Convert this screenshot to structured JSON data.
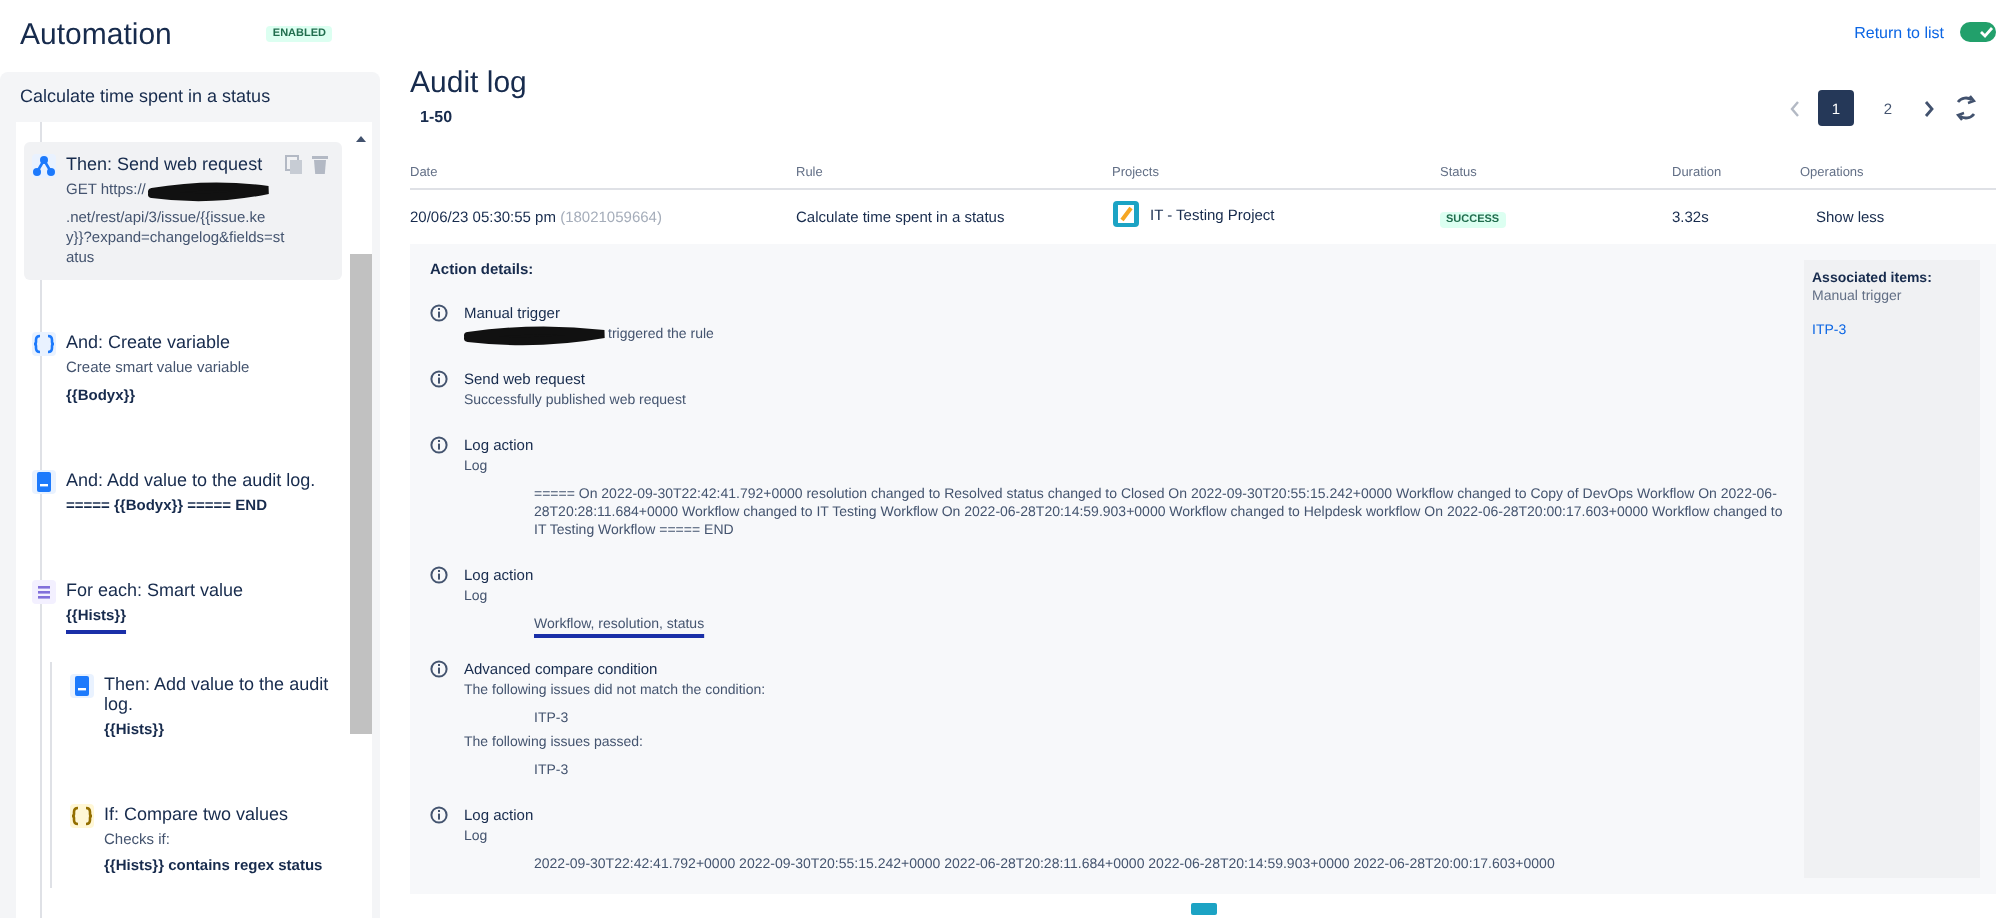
{
  "header": {
    "title": "Automation",
    "status_badge": "ENABLED",
    "return_link": "Return to list",
    "toggle": {
      "on": true
    }
  },
  "sidebar": {
    "rule_name": "Calculate time spent in a status",
    "steps": [
      {
        "kind": "web-request",
        "title": "Then: Send web request",
        "selected": true,
        "parts": [
          {
            "kind": "text",
            "text": "GET https://"
          },
          {
            "kind": "redacted"
          },
          {
            "kind": "break"
          },
          {
            "kind": "text",
            "text": ".net/rest/api/3/issue/{{issue.key}}?expand=changelog&fields=status"
          }
        ]
      },
      {
        "kind": "variable",
        "title": "And: Create variable",
        "selected": false,
        "parts": [
          {
            "kind": "text",
            "text": "Create smart value variable"
          },
          {
            "kind": "value",
            "text": "{{Bodyx}}"
          }
        ]
      },
      {
        "kind": "log",
        "title": "And: Add value to the audit log.",
        "selected": false,
        "parts": [
          {
            "kind": "value",
            "text": "===== {{Bodyx}} ===== END"
          }
        ]
      },
      {
        "kind": "branch",
        "title": "For each: Smart value",
        "selected": false,
        "parts": [
          {
            "kind": "value",
            "text": "{{Hists}}",
            "underlined": true
          }
        ],
        "children": [
          {
            "kind": "log",
            "title": "Then: Add value to the audit log.",
            "selected": false,
            "parts": [
              {
                "kind": "value",
                "text": "{{Hists}}"
              }
            ]
          },
          {
            "kind": "condition",
            "title": "If: Compare two values",
            "selected": false,
            "parts": [
              {
                "kind": "text",
                "text": "Checks if:"
              },
              {
                "kind": "value",
                "text": "{{Hists}} contains regex status"
              }
            ]
          }
        ]
      }
    ]
  },
  "audit_log": {
    "title": "Audit log",
    "range": "1-50",
    "pages": [
      {
        "label": "1",
        "selected": true
      },
      {
        "label": "2",
        "selected": false
      }
    ],
    "table": {
      "columns": [
        "Date",
        "Rule",
        "Projects",
        "Status",
        "Duration",
        "Operations"
      ],
      "rows": [
        {
          "date": "20/06/23 05:30:55 pm",
          "id": "(18021059664)",
          "rule": "Calculate time spent in a status",
          "project": "IT - Testing Project",
          "status": "SUCCESS",
          "duration": "3.32s",
          "operation": "Show less",
          "expanded": true
        }
      ]
    },
    "details": {
      "heading": "Action details:",
      "actions": [
        {
          "title": "Manual trigger",
          "lines": [
            {
              "kind": "redacted-text",
              "text": "triggered the rule"
            }
          ]
        },
        {
          "title": "Send web request",
          "lines": [
            {
              "kind": "text",
              "text": "Successfully published web request"
            }
          ]
        },
        {
          "title": "Log action",
          "lines": [
            {
              "kind": "text",
              "text": "Log"
            },
            {
              "kind": "value",
              "text": "===== On 2022-09-30T22:42:41.792+0000 resolution changed to Resolved status changed to Closed On 2022-09-30T20:55:15.242+0000 Workflow changed to Copy of DevOps Workflow On 2022-06-28T20:28:11.684+0000 Workflow changed to IT Testing Workflow On 2022-06-28T20:14:59.903+0000 Workflow changed to Helpdesk workflow On 2022-06-28T20:00:17.603+0000 Workflow changed to IT Testing Workflow ===== END"
            }
          ]
        },
        {
          "title": "Log action",
          "lines": [
            {
              "kind": "text",
              "text": "Log"
            },
            {
              "kind": "value",
              "text": "Workflow, resolution, status",
              "underlined": true
            }
          ]
        },
        {
          "title": "Advanced compare condition",
          "lines": [
            {
              "kind": "text",
              "text": "The following issues did not match the condition:"
            },
            {
              "kind": "value",
              "text": "ITP-3"
            },
            {
              "kind": "text",
              "text": "The following issues passed:"
            },
            {
              "kind": "value",
              "text": "ITP-3"
            }
          ]
        },
        {
          "title": "Log action",
          "lines": [
            {
              "kind": "text",
              "text": "Log"
            },
            {
              "kind": "value",
              "text": "2022-09-30T22:42:41.792+0000 2022-09-30T20:55:15.242+0000 2022-06-28T20:28:11.684+0000 2022-06-28T20:14:59.903+0000 2022-06-28T20:00:17.603+0000"
            }
          ]
        }
      ],
      "associated": {
        "heading": "Associated items:",
        "trigger": "Manual trigger",
        "items": [
          "ITP-3"
        ]
      }
    }
  }
}
